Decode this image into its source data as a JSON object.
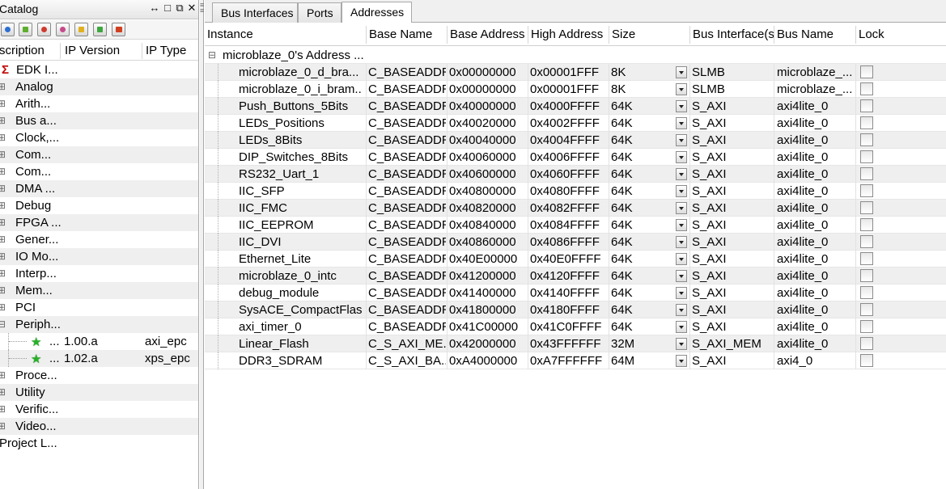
{
  "catalog": {
    "title": "Catalog",
    "header": {
      "description": "scription",
      "ip_version": "IP Version",
      "ip_type": "IP Type"
    },
    "toolbar_icons": [
      "add-ip-icon",
      "add-repository-icon",
      "refresh-icon",
      "config-icon",
      "lock-icon",
      "component-icon",
      "palette-icon"
    ],
    "items": [
      {
        "name": "EDK I...",
        "kind": "root"
      },
      {
        "name": "Analog",
        "kind": "group"
      },
      {
        "name": "Arith...",
        "kind": "group"
      },
      {
        "name": "Bus a...",
        "kind": "group"
      },
      {
        "name": "Clock,...",
        "kind": "group"
      },
      {
        "name": "Com...",
        "kind": "group"
      },
      {
        "name": "Com...",
        "kind": "group"
      },
      {
        "name": "DMA ...",
        "kind": "group"
      },
      {
        "name": "Debug",
        "kind": "group"
      },
      {
        "name": "FPGA ...",
        "kind": "group"
      },
      {
        "name": "Gener...",
        "kind": "group"
      },
      {
        "name": "IO Mo...",
        "kind": "group"
      },
      {
        "name": "Interp...",
        "kind": "group"
      },
      {
        "name": "Mem...",
        "kind": "group"
      },
      {
        "name": "PCI",
        "kind": "group"
      },
      {
        "name": "Periph...",
        "kind": "expanded"
      },
      {
        "name": "...",
        "version": "1.00.a",
        "type": "axi_epc",
        "kind": "leaf"
      },
      {
        "name": "...",
        "version": "1.02.a",
        "type": "xps_epc",
        "kind": "leaf"
      },
      {
        "name": "Proce...",
        "kind": "group"
      },
      {
        "name": "Utility",
        "kind": "group"
      },
      {
        "name": "Verific...",
        "kind": "group"
      },
      {
        "name": "Video...",
        "kind": "group"
      },
      {
        "name": "Project L...",
        "kind": "plain"
      }
    ]
  },
  "tabs": [
    {
      "label": "Bus Interfaces"
    },
    {
      "label": "Ports"
    },
    {
      "label": "Addresses",
      "active": true
    }
  ],
  "table": {
    "columns": [
      "Instance",
      "Base Name",
      "Base Address",
      "High Address",
      "Size",
      "Bus Interface(s",
      "Bus Name",
      "Lock"
    ],
    "group": "microblaze_0's Address ...",
    "rows": [
      {
        "instance": "microblaze_0_d_bra...",
        "base_name": "C_BASEADDR",
        "base": "0x00000000",
        "high": "0x00001FFF",
        "size": "8K",
        "bus_if": "SLMB",
        "bus_name": "microblaze_..."
      },
      {
        "instance": "microblaze_0_i_bram...",
        "base_name": "C_BASEADDR",
        "base": "0x00000000",
        "high": "0x00001FFF",
        "size": "8K",
        "bus_if": "SLMB",
        "bus_name": "microblaze_..."
      },
      {
        "instance": "Push_Buttons_5Bits",
        "base_name": "C_BASEADDR",
        "base": "0x40000000",
        "high": "0x4000FFFF",
        "size": "64K",
        "bus_if": "S_AXI",
        "bus_name": "axi4lite_0"
      },
      {
        "instance": "LEDs_Positions",
        "base_name": "C_BASEADDR",
        "base": "0x40020000",
        "high": "0x4002FFFF",
        "size": "64K",
        "bus_if": "S_AXI",
        "bus_name": "axi4lite_0"
      },
      {
        "instance": "LEDs_8Bits",
        "base_name": "C_BASEADDR",
        "base": "0x40040000",
        "high": "0x4004FFFF",
        "size": "64K",
        "bus_if": "S_AXI",
        "bus_name": "axi4lite_0"
      },
      {
        "instance": "DIP_Switches_8Bits",
        "base_name": "C_BASEADDR",
        "base": "0x40060000",
        "high": "0x4006FFFF",
        "size": "64K",
        "bus_if": "S_AXI",
        "bus_name": "axi4lite_0"
      },
      {
        "instance": "RS232_Uart_1",
        "base_name": "C_BASEADDR",
        "base": "0x40600000",
        "high": "0x4060FFFF",
        "size": "64K",
        "bus_if": "S_AXI",
        "bus_name": "axi4lite_0"
      },
      {
        "instance": "IIC_SFP",
        "base_name": "C_BASEADDR",
        "base": "0x40800000",
        "high": "0x4080FFFF",
        "size": "64K",
        "bus_if": "S_AXI",
        "bus_name": "axi4lite_0"
      },
      {
        "instance": "IIC_FMC",
        "base_name": "C_BASEADDR",
        "base": "0x40820000",
        "high": "0x4082FFFF",
        "size": "64K",
        "bus_if": "S_AXI",
        "bus_name": "axi4lite_0"
      },
      {
        "instance": "IIC_EEPROM",
        "base_name": "C_BASEADDR",
        "base": "0x40840000",
        "high": "0x4084FFFF",
        "size": "64K",
        "bus_if": "S_AXI",
        "bus_name": "axi4lite_0"
      },
      {
        "instance": "IIC_DVI",
        "base_name": "C_BASEADDR",
        "base": "0x40860000",
        "high": "0x4086FFFF",
        "size": "64K",
        "bus_if": "S_AXI",
        "bus_name": "axi4lite_0"
      },
      {
        "instance": "Ethernet_Lite",
        "base_name": "C_BASEADDR",
        "base": "0x40E00000",
        "high": "0x40E0FFFF",
        "size": "64K",
        "bus_if": "S_AXI",
        "bus_name": "axi4lite_0"
      },
      {
        "instance": "microblaze_0_intc",
        "base_name": "C_BASEADDR",
        "base": "0x41200000",
        "high": "0x4120FFFF",
        "size": "64K",
        "bus_if": "S_AXI",
        "bus_name": "axi4lite_0"
      },
      {
        "instance": "debug_module",
        "base_name": "C_BASEADDR",
        "base": "0x41400000",
        "high": "0x4140FFFF",
        "size": "64K",
        "bus_if": "S_AXI",
        "bus_name": "axi4lite_0"
      },
      {
        "instance": "SysACE_CompactFlash",
        "base_name": "C_BASEADDR",
        "base": "0x41800000",
        "high": "0x4180FFFF",
        "size": "64K",
        "bus_if": "S_AXI",
        "bus_name": "axi4lite_0"
      },
      {
        "instance": "axi_timer_0",
        "base_name": "C_BASEADDR",
        "base": "0x41C00000",
        "high": "0x41C0FFFF",
        "size": "64K",
        "bus_if": "S_AXI",
        "bus_name": "axi4lite_0"
      },
      {
        "instance": "Linear_Flash",
        "base_name": "C_S_AXI_ME...",
        "base": "0x42000000",
        "high": "0x43FFFFFF",
        "size": "32M",
        "bus_if": "S_AXI_MEM",
        "bus_name": "axi4lite_0"
      },
      {
        "instance": "DDR3_SDRAM",
        "base_name": "C_S_AXI_BA...",
        "base": "0xA4000000",
        "high": "0xA7FFFFFF",
        "size": "64M",
        "bus_if": "S_AXI",
        "bus_name": "axi4_0"
      }
    ]
  }
}
